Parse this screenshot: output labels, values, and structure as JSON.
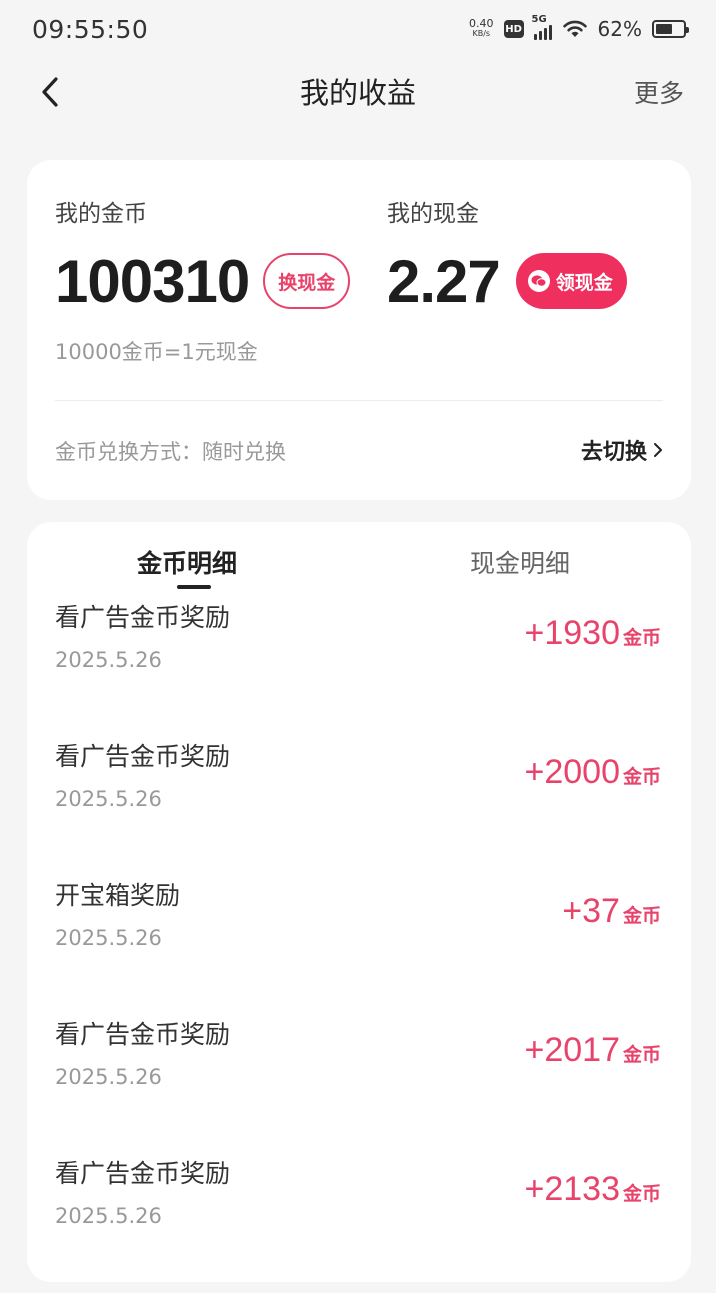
{
  "status": {
    "time": "09:55:50",
    "net_speed_value": "0.40",
    "net_speed_unit": "KB/s",
    "hd": "HD",
    "network": "5G",
    "battery": "62%"
  },
  "nav": {
    "title": "我的收益",
    "more": "更多"
  },
  "earnings": {
    "coins_label": "我的金币",
    "coins_value": "100310",
    "exchange_button": "换现金",
    "cash_label": "我的现金",
    "cash_value": "2.27",
    "claim_button": "领现金",
    "rate": "10000金币=1元现金",
    "method": "金币兑换方式：随时兑换",
    "switch": "去切换"
  },
  "tabs": {
    "coins": "金币明细",
    "cash": "现金明细"
  },
  "records": [
    {
      "title": "看广告金币奖励",
      "date": "2025.5.26",
      "amount": "+1930",
      "unit": "金币"
    },
    {
      "title": "看广告金币奖励",
      "date": "2025.5.26",
      "amount": "+2000",
      "unit": "金币"
    },
    {
      "title": "开宝箱奖励",
      "date": "2025.5.26",
      "amount": "+37",
      "unit": "金币"
    },
    {
      "title": "看广告金币奖励",
      "date": "2025.5.26",
      "amount": "+2017",
      "unit": "金币"
    },
    {
      "title": "看广告金币奖励",
      "date": "2025.5.26",
      "amount": "+2133",
      "unit": "金币"
    }
  ],
  "colors": {
    "accent": "#e8436b",
    "claim_bg": "#ef2f5e",
    "background": "#f5f5f5"
  }
}
